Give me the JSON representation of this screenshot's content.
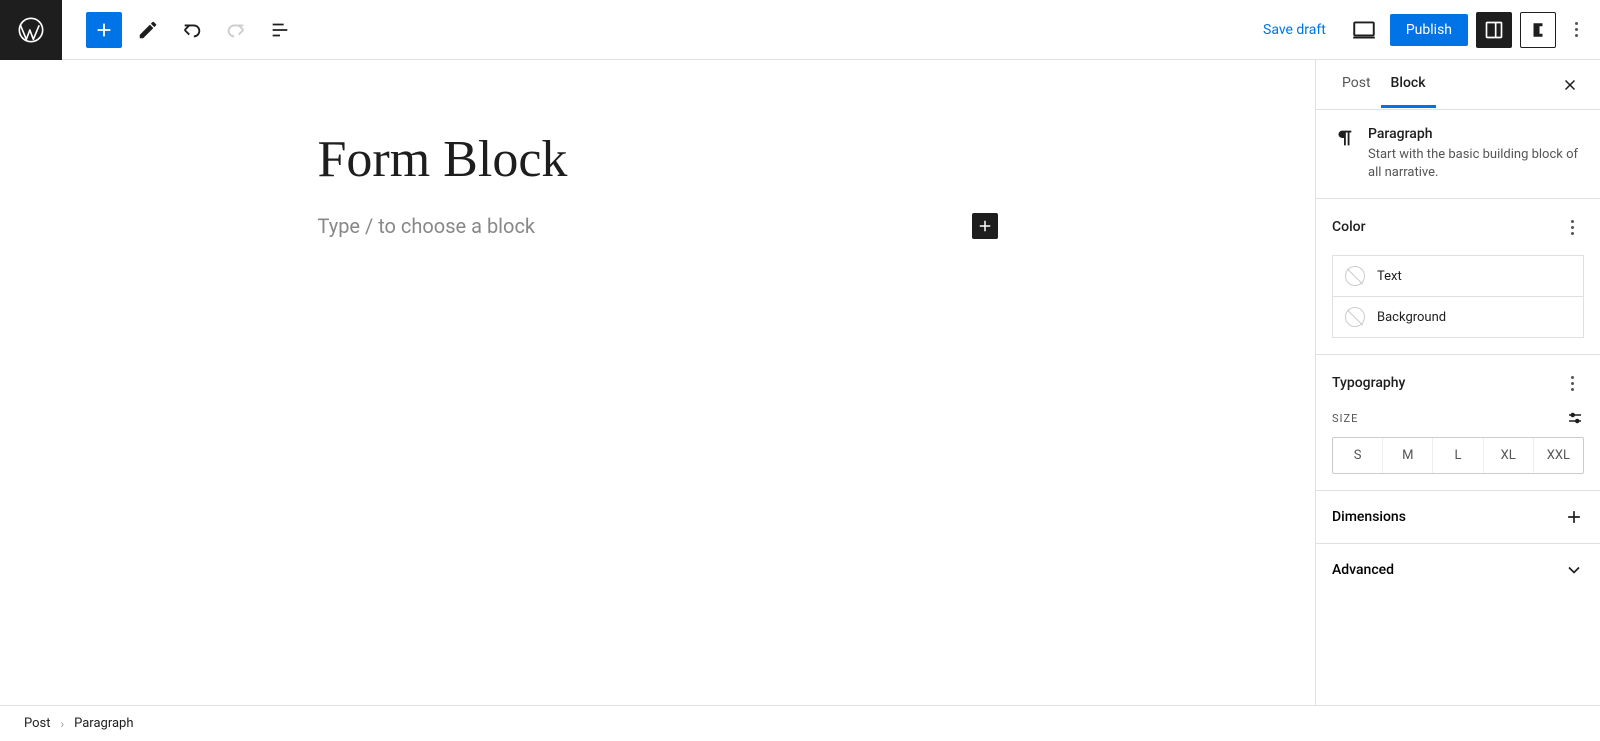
{
  "toolbar": {
    "save_draft": "Save draft",
    "publish": "Publish"
  },
  "post": {
    "title": "Form Block",
    "paragraph_placeholder": "Type / to choose a block"
  },
  "sidebar": {
    "tabs": {
      "post": "Post",
      "block": "Block"
    },
    "block_info": {
      "title": "Paragraph",
      "description": "Start with the basic building block of all narrative."
    },
    "panels": {
      "color": {
        "title": "Color",
        "text_label": "Text",
        "background_label": "Background"
      },
      "typography": {
        "title": "Typography",
        "size_label": "SIZE",
        "sizes": [
          "S",
          "M",
          "L",
          "XL",
          "XXL"
        ]
      },
      "dimensions": {
        "title": "Dimensions"
      },
      "advanced": {
        "title": "Advanced"
      }
    }
  },
  "footer": {
    "crumb_root": "Post",
    "crumb_leaf": "Paragraph"
  }
}
